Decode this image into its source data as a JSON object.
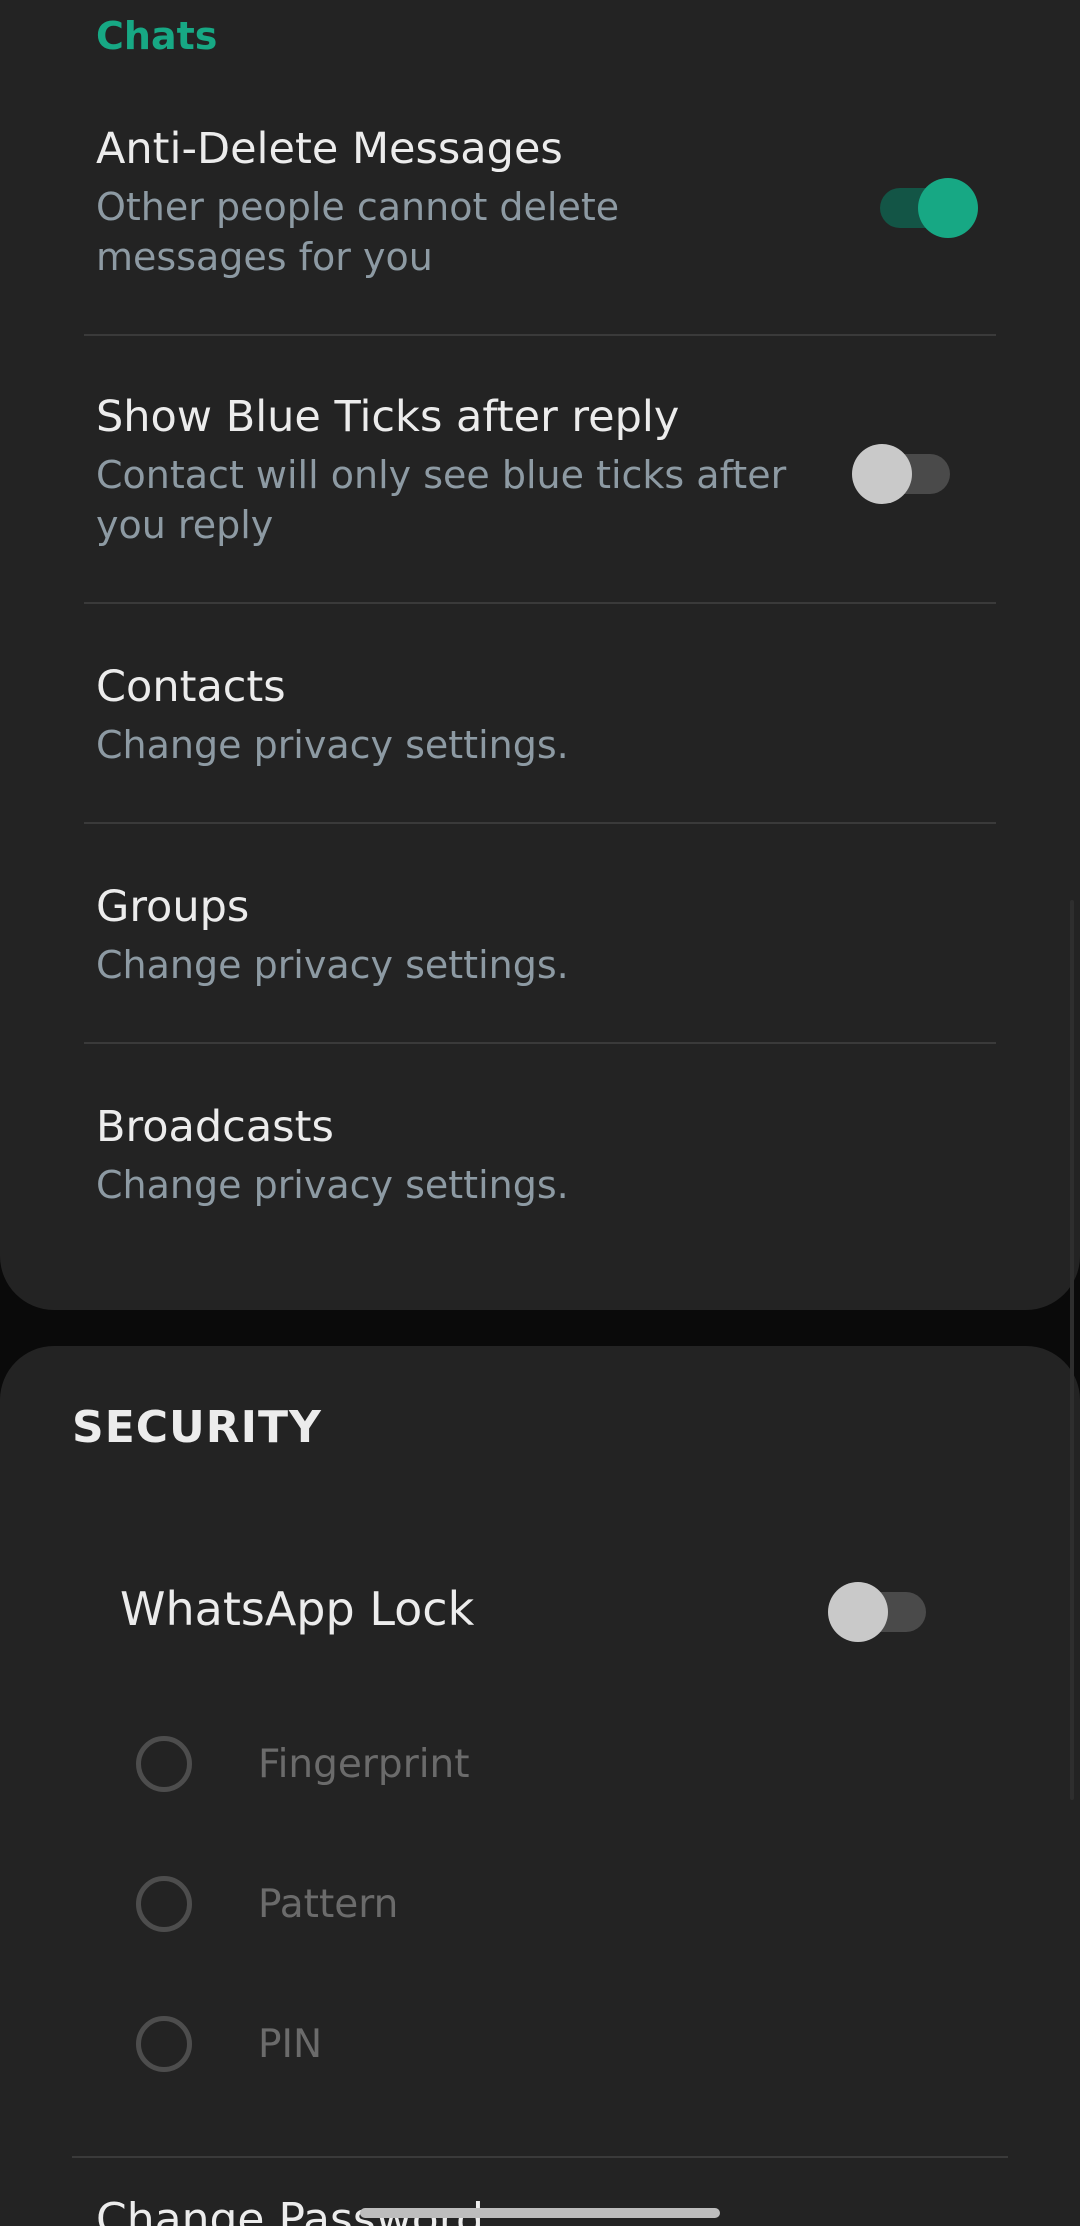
{
  "chats_section": {
    "label": "Chats",
    "items": [
      {
        "title": "Anti-Delete Messages",
        "subtitle_line1": "Other people cannot delete",
        "subtitle_line2": "messages for you",
        "toggle": "on"
      },
      {
        "title": "Show Blue Ticks after reply",
        "subtitle_line1": "Contact will only see blue ticks after",
        "subtitle_line2": "you reply",
        "toggle": "off"
      },
      {
        "title": "Contacts",
        "subtitle": "Change privacy settings."
      },
      {
        "title": "Groups",
        "subtitle": "Change privacy settings."
      },
      {
        "title": "Broadcasts",
        "subtitle": "Change privacy settings."
      }
    ]
  },
  "security_section": {
    "header": "SECURITY",
    "lock": {
      "title": "WhatsApp Lock",
      "toggle": "off"
    },
    "options": [
      {
        "label": "Fingerprint",
        "selected": false
      },
      {
        "label": "Pattern",
        "selected": false
      },
      {
        "label": "PIN",
        "selected": false
      }
    ],
    "next_item_partial": "Change Password"
  },
  "colors": {
    "accent": "#17a884",
    "background": "#0a0a0a",
    "card": "#232323",
    "subtitle": "#8d9aa3"
  }
}
